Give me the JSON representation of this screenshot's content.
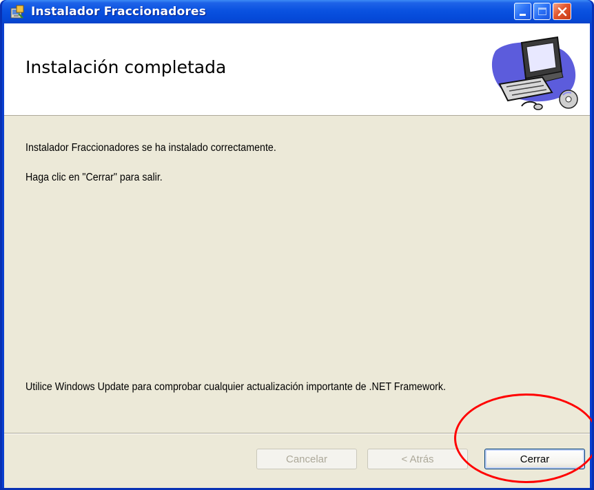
{
  "window": {
    "title": "Instalador Fraccionadores",
    "controls": {
      "minimize": "minimize",
      "maximize": "maximize",
      "close": "close"
    }
  },
  "banner": {
    "heading": "Instalación completada",
    "art_icon": "computer-cd-icon"
  },
  "messages": {
    "success": "Instalador Fraccionadores se ha instalado correctamente.",
    "exit_hint": "Haga clic en \"Cerrar\" para salir.",
    "update_hint": "Utilice Windows Update para comprobar cualquier actualización importante de .NET Framework."
  },
  "buttons": {
    "cancel": "Cancelar",
    "back": "< Atrás",
    "close": "Cerrar"
  },
  "colors": {
    "titlebar": "#0a52e0",
    "client_bg": "#ece9d8",
    "highlight": "#ff0000"
  }
}
